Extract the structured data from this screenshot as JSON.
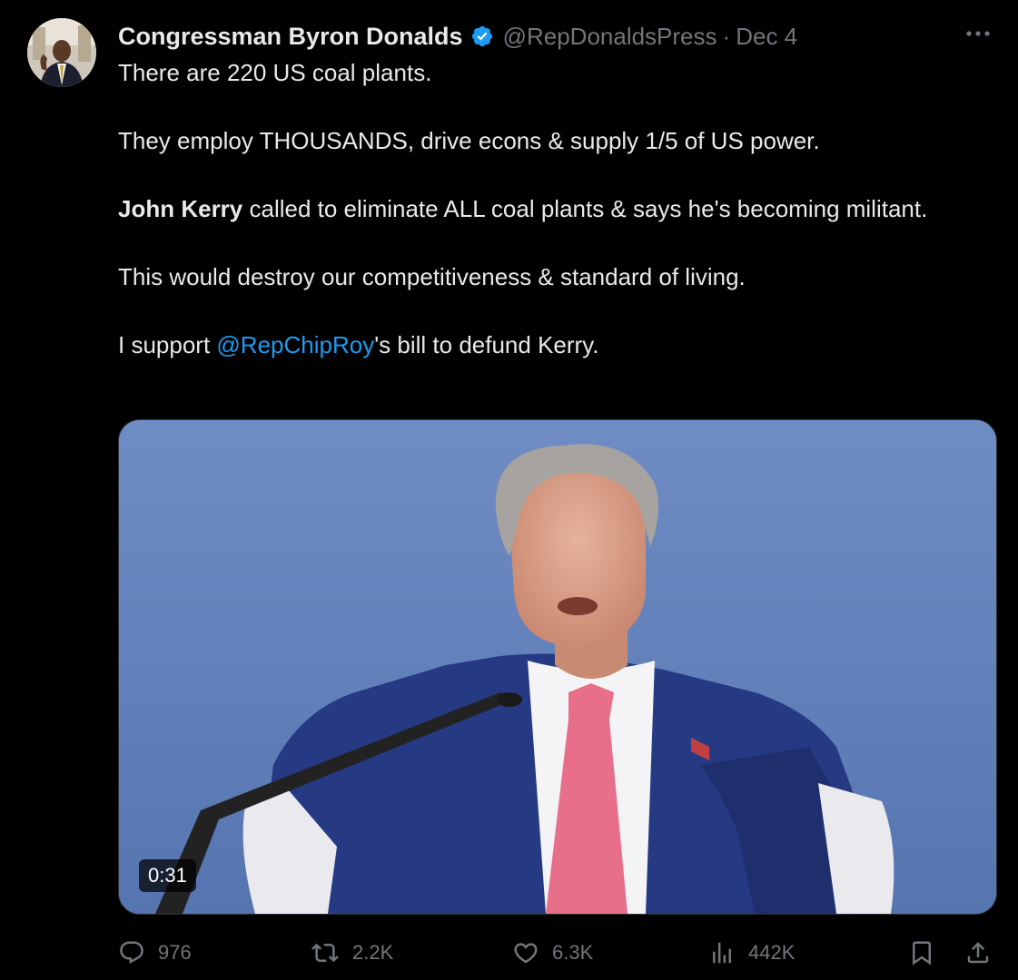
{
  "author": {
    "display_name": "Congressman Byron Donalds",
    "handle": "@RepDonaldsPress",
    "separator": "·",
    "date": "Dec 4",
    "verified": true,
    "avatar_icon": "person-avatar"
  },
  "tweet": {
    "line1": "There are 220 US coal plants.",
    "line2": "They employ THOUSANDS, drive econs & supply 1/5 of US power.",
    "line3_bold": "John Kerry",
    "line3_rest": " called to eliminate ALL coal plants & says he's becoming militant.",
    "line4": "This would destroy our competitiveness & standard of living.",
    "line5_pre": "I support ",
    "line5_mention": "@RepChipRoy",
    "line5_post": "'s bill to defund Kerry."
  },
  "media": {
    "type": "video",
    "duration": "0:31"
  },
  "actions": {
    "replies": "976",
    "reposts": "2.2K",
    "likes": "6.3K",
    "views": "442K"
  },
  "colors": {
    "background": "#000000",
    "text": "#e7e9ea",
    "muted": "#71767b",
    "link": "#1d9bf0",
    "verified": "#1d9bf0"
  }
}
